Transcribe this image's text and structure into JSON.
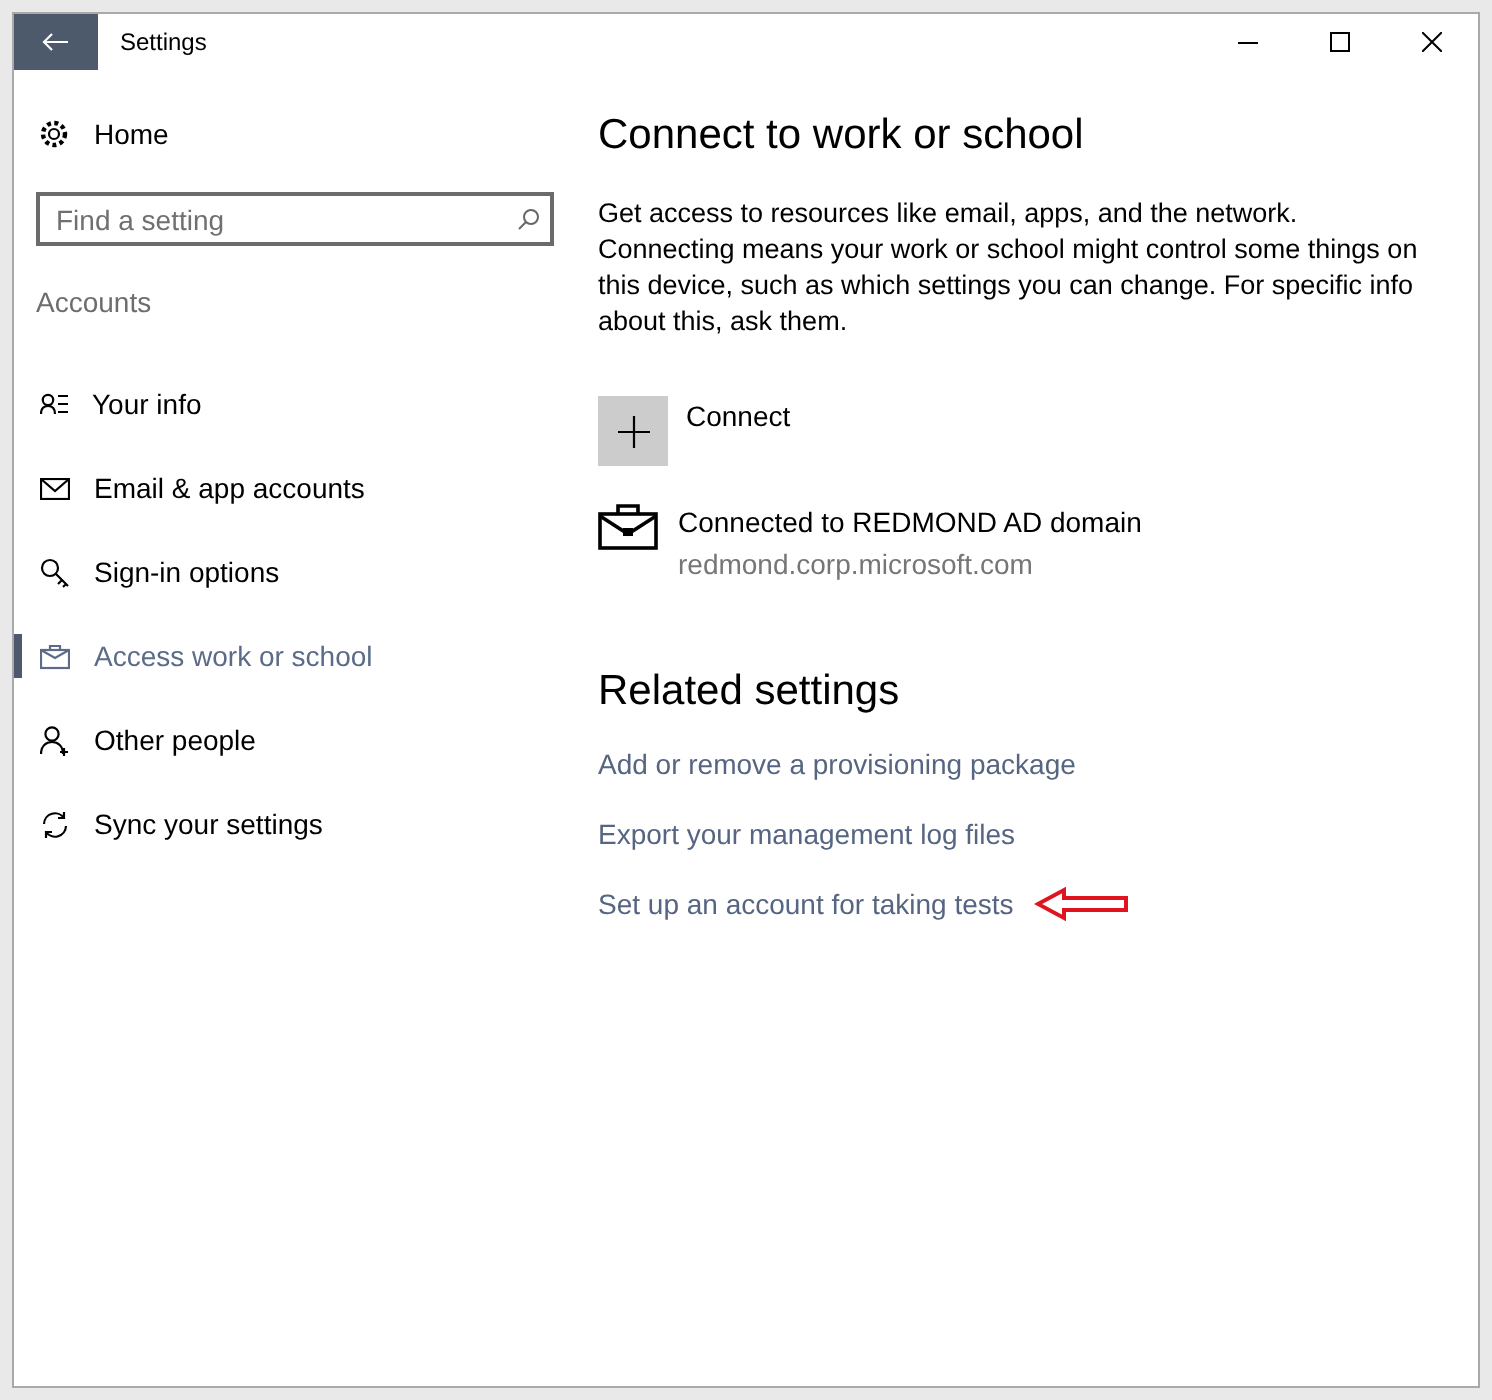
{
  "window": {
    "title": "Settings"
  },
  "sidebar": {
    "home": "Home",
    "search": {
      "placeholder": "Find a setting"
    },
    "section": "Accounts",
    "items": [
      {
        "label": "Your info",
        "kind": "info",
        "selected": false
      },
      {
        "label": "Email & app accounts",
        "kind": "mail",
        "selected": false
      },
      {
        "label": "Sign-in options",
        "kind": "key",
        "selected": false
      },
      {
        "label": "Access work or school",
        "kind": "briefcase",
        "selected": true
      },
      {
        "label": "Other people",
        "kind": "person",
        "selected": false
      },
      {
        "label": "Sync your settings",
        "kind": "sync",
        "selected": false
      }
    ]
  },
  "main": {
    "heading": "Connect to work or school",
    "description": "Get access to resources like email, apps, and the network. Connecting means your work or school might control some things on this device, such as which settings you can change. For specific info about this, ask them.",
    "connect": "Connect",
    "account": {
      "title": "Connected to REDMOND AD domain",
      "subtitle": "redmond.corp.microsoft.com"
    },
    "related": {
      "heading": "Related settings",
      "links": [
        {
          "label": "Add or remove a provisioning package",
          "marked": false
        },
        {
          "label": "Export your management log files",
          "marked": false
        },
        {
          "label": "Set up an account for taking tests",
          "marked": true
        }
      ]
    }
  }
}
